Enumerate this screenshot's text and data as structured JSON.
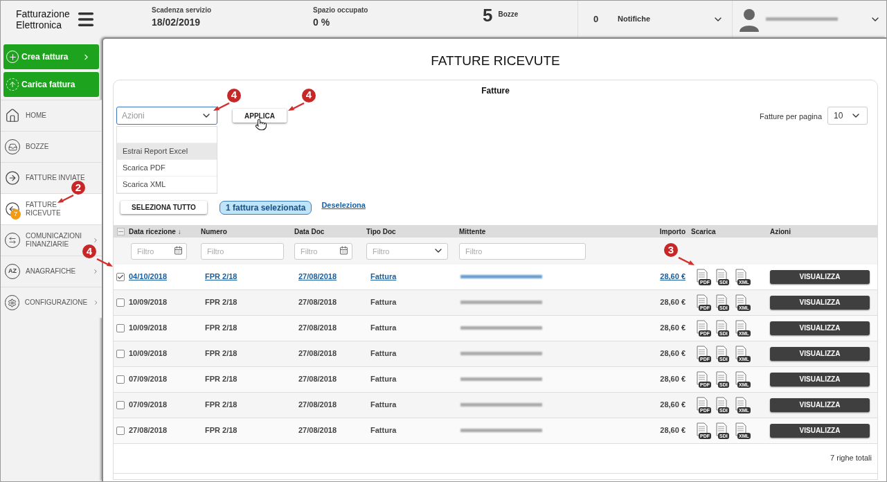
{
  "header": {
    "logo": "Fatturazione Elettronica",
    "service_expiry": {
      "label": "Scadenza servizio",
      "value": "18/02/2019"
    },
    "space_used": {
      "label": "Spazio occupato",
      "value": "0 %"
    },
    "drafts": {
      "count": "5",
      "label": "Bozze"
    },
    "notifications": {
      "count": "0",
      "label": "Notifiche"
    }
  },
  "sidebar": {
    "actions": [
      {
        "label": "Crea fattura",
        "kind": "create"
      },
      {
        "label": "Carica fattura",
        "kind": "upload"
      }
    ],
    "items": [
      {
        "label": "HOME",
        "selected": false,
        "submenu": false
      },
      {
        "label": "BOZZE",
        "selected": false,
        "submenu": false
      },
      {
        "label": "FATTURE INVIATE",
        "selected": false,
        "submenu": false
      },
      {
        "label": "FATTURE RICEVUTE",
        "selected": true,
        "submenu": false,
        "badge": "7",
        "marker": "2"
      },
      {
        "label": "COMUNICAZIONI FINANZIARIE",
        "selected": false,
        "submenu": true
      },
      {
        "label": "ANAGRAFICHE",
        "icon_text": "AZ",
        "selected": false,
        "submenu": true
      },
      {
        "label": "CONFIGURAZIONE",
        "selected": false,
        "submenu": true
      }
    ]
  },
  "page_title": "FATTURE RICEVUTE",
  "tab": "Fatture",
  "actions_select": {
    "placeholder": "Azioni",
    "marker": "4",
    "expanded": true,
    "options": [
      {
        "highlighted": false
      },
      {
        "label": "Estrai Report Excel",
        "highlighted": true
      },
      {
        "label": "Scarica PDF",
        "highlighted": false
      },
      {
        "label": "Scarica XML",
        "highlighted": false
      }
    ]
  },
  "apply_button": {
    "label": "APPLICA",
    "marker": "4"
  },
  "per_page": {
    "label": "Fatture per pagina",
    "value": "10"
  },
  "select_all": "SELEZIONA TUTTO",
  "selection_badge": "1 fattura selezionata",
  "deselect_link": "Deseleziona",
  "table": {
    "columns": [
      "Data ricezione",
      "Numero",
      "Data Doc",
      "Tipo Doc",
      "Mittente",
      "Importo",
      "Scarica",
      "Azioni"
    ],
    "sort_indicator": "↓",
    "filters": [
      {
        "kind": "date",
        "placeholder": "Filtro"
      },
      {
        "kind": "text",
        "placeholder": "Filtro"
      },
      {
        "kind": "date",
        "placeholder": "Filtro"
      },
      {
        "kind": "select",
        "placeholder": "Filtro"
      },
      {
        "kind": "text",
        "placeholder": "Filtro"
      }
    ],
    "rows": [
      {
        "checked": true,
        "marker": "4",
        "download_marker": "3",
        "date": "04/10/2018",
        "number": "FPR 2/18",
        "doc_date": "27/08/2018",
        "type": "Fattura",
        "amount": "28,60 €",
        "downloads": [
          "PDF",
          "SDI",
          "XML"
        ],
        "action": "VISUALIZZA"
      },
      {
        "checked": false,
        "date": "10/09/2018",
        "number": "FPR 2/18",
        "doc_date": "27/08/2018",
        "type": "Fattura",
        "amount": "28,60 €",
        "downloads": [
          "PDF",
          "SDI",
          "XML"
        ],
        "action": "VISUALIZZA"
      },
      {
        "checked": false,
        "date": "10/09/2018",
        "number": "FPR 2/18",
        "doc_date": "27/08/2018",
        "type": "Fattura",
        "amount": "28,60 €",
        "downloads": [
          "PDF",
          "SDI",
          "XML"
        ],
        "action": "VISUALIZZA"
      },
      {
        "checked": false,
        "date": "10/09/2018",
        "number": "FPR 2/18",
        "doc_date": "27/08/2018",
        "type": "Fattura",
        "amount": "28,60 €",
        "downloads": [
          "PDF",
          "SDI",
          "XML"
        ],
        "action": "VISUALIZZA"
      },
      {
        "checked": false,
        "date": "07/09/2018",
        "number": "FPR 2/18",
        "doc_date": "27/08/2018",
        "type": "Fattura",
        "amount": "28,60 €",
        "downloads": [
          "PDF",
          "SDI",
          "XML"
        ],
        "action": "VISUALIZZA"
      },
      {
        "checked": false,
        "date": "07/09/2018",
        "number": "FPR 2/18",
        "doc_date": "27/08/2018",
        "type": "Fattura",
        "amount": "28,60 €",
        "downloads": [
          "PDF",
          "SDI",
          "XML"
        ],
        "action": "VISUALIZZA"
      },
      {
        "checked": false,
        "date": "27/08/2018",
        "number": "FPR 2/18",
        "doc_date": "27/08/2018",
        "type": "Fattura",
        "amount": "28,60 €",
        "downloads": [
          "PDF",
          "SDI",
          "XML"
        ],
        "action": "VISUALIZZA"
      }
    ],
    "total": "7 righe totali"
  }
}
